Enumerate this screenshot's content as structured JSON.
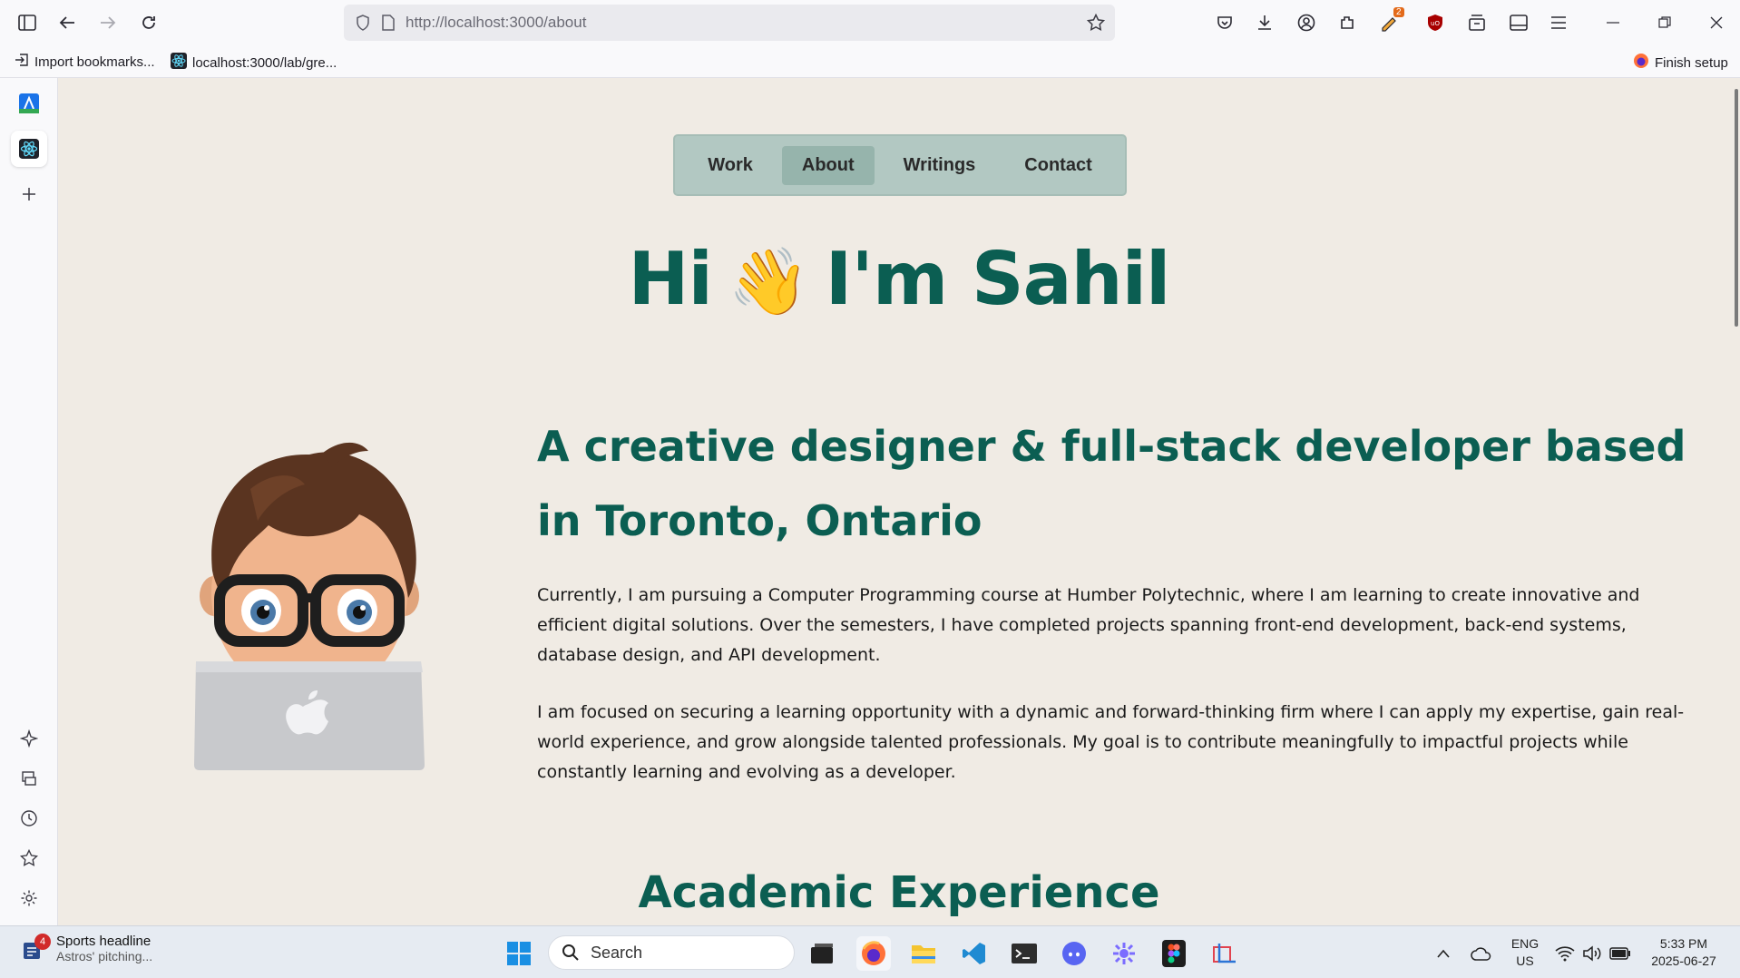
{
  "browser": {
    "url": "http://localhost:3000/about",
    "bookmarks": [
      {
        "label": "Import bookmarks..."
      },
      {
        "label": "localhost:3000/lab/gre..."
      }
    ],
    "finish_setup": "Finish setup",
    "extension_badge": "2"
  },
  "nav": {
    "items": [
      {
        "label": "Work"
      },
      {
        "label": "About"
      },
      {
        "label": "Writings"
      },
      {
        "label": "Contact"
      }
    ],
    "active": "About"
  },
  "hero": {
    "greeting": "Hi",
    "wave_emoji": "👋",
    "name": "I'm Sahil"
  },
  "about": {
    "tagline": "A creative designer & full-stack developer based in Toronto, Ontario",
    "paragraph1": "Currently, I am pursuing a Computer Programming course at Humber Polytechnic, where I am learning to create innovative and efficient digital solutions. Over the semesters, I have completed projects spanning front-end development, back-end systems, database design, and API development.",
    "paragraph2": "I am focused on securing a learning opportunity with a dynamic and forward-thinking firm where I can apply my expertise, gain real-world experience, and grow alongside talented professionals. My goal is to contribute meaningfully to impactful projects while constantly learning and evolving as a developer."
  },
  "sections": {
    "academic": "Academic Experience"
  },
  "taskbar": {
    "news_title": "Sports headline",
    "news_sub": "Astros' pitching...",
    "news_badge": "4",
    "search_placeholder": "Search",
    "lang_top": "ENG",
    "lang_bottom": "US",
    "time": "5:33 PM",
    "date": "2025-06-27"
  },
  "colors": {
    "accent": "#0b5e52",
    "page_bg": "#f0ebe4",
    "nav_bg": "#b2c8c2"
  }
}
